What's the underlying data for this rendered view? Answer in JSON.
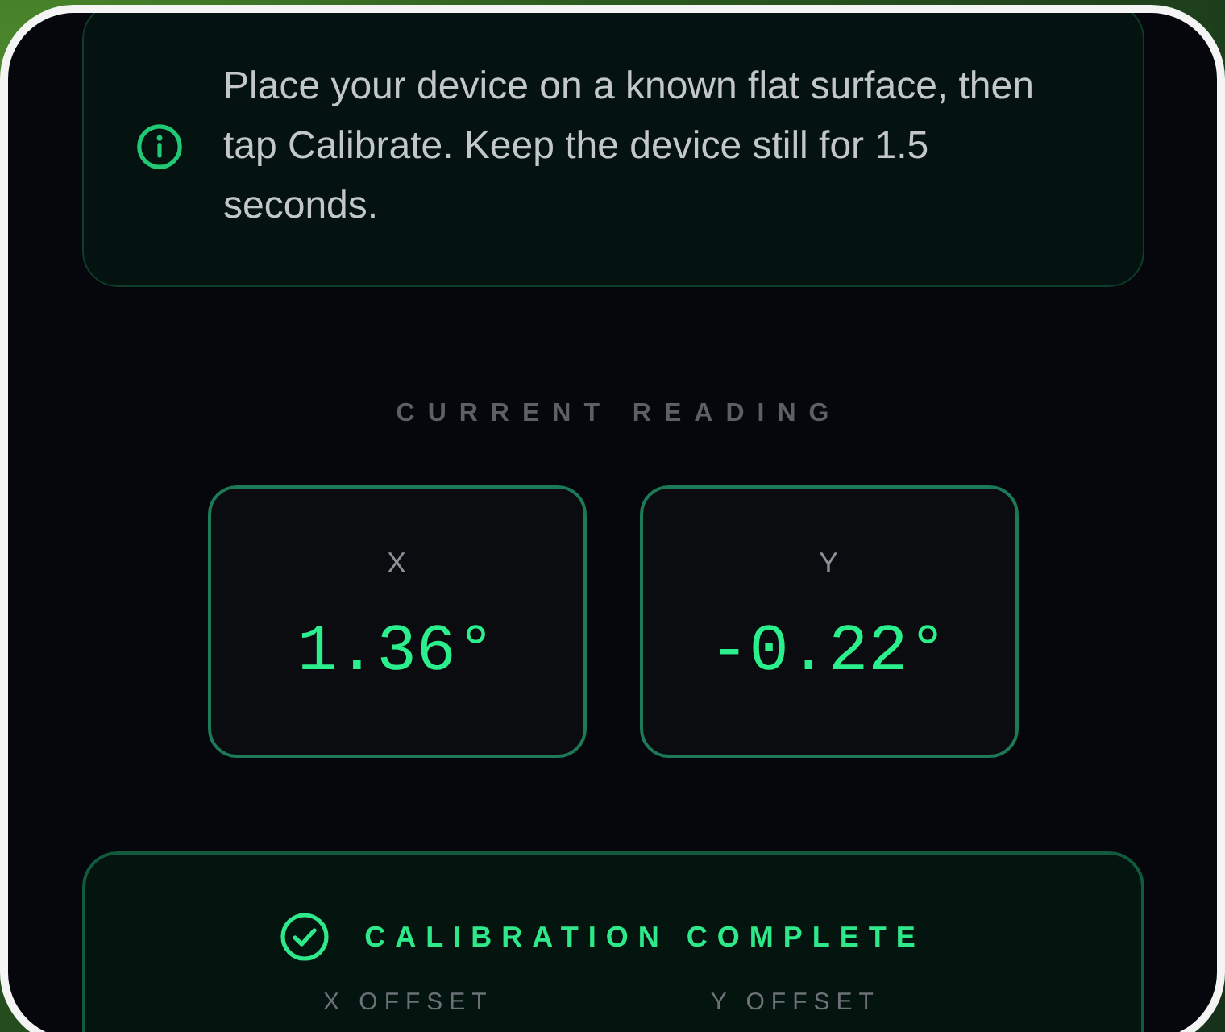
{
  "info_banner": {
    "text": "Place your device on a known flat surface, then\ntap Calibrate. Keep the device still for 1.5\nseconds."
  },
  "current_reading": {
    "title": "CURRENT READING",
    "axes": [
      {
        "label": "X",
        "value": "1.36°"
      },
      {
        "label": "Y",
        "value": "-0.22°"
      }
    ]
  },
  "calibration_status": {
    "kind": "success",
    "title": "CALIBRATION COMPLETE",
    "offsets": [
      {
        "label": "X OFFSET"
      },
      {
        "label": "Y OFFSET"
      }
    ]
  }
}
